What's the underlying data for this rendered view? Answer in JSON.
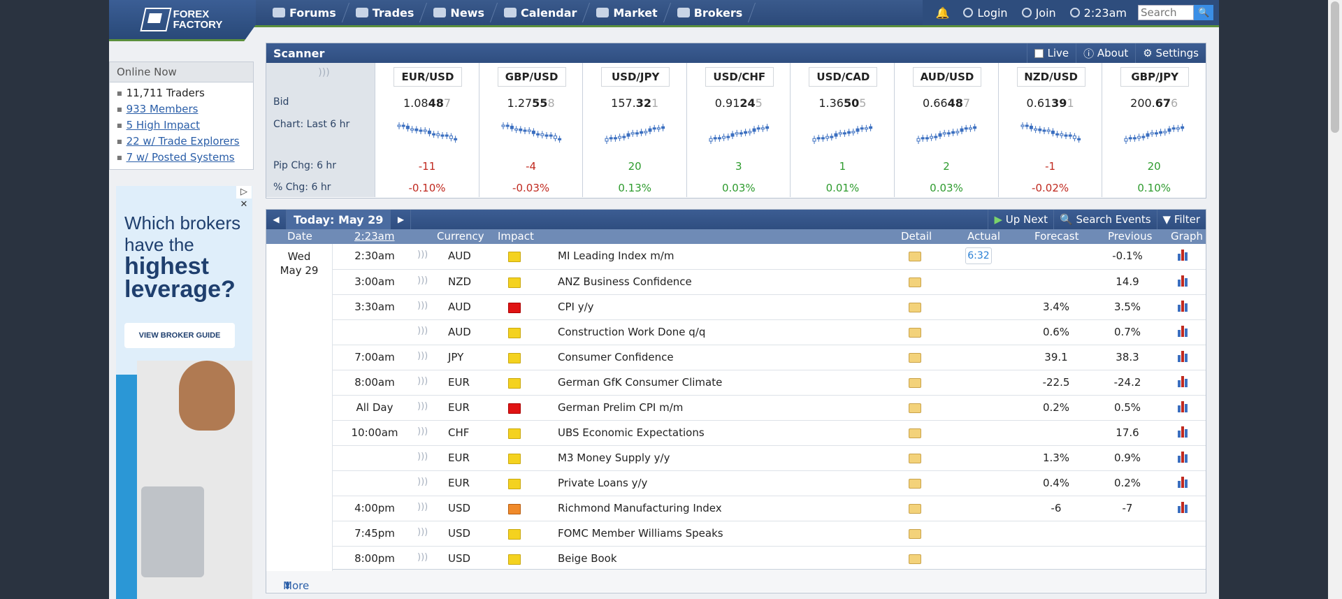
{
  "brand": {
    "logo_text_1": "FOREX",
    "logo_text_2": "FACTORY"
  },
  "nav": {
    "forums": "Forums",
    "trades": "Trades",
    "news": "News",
    "calendar": "Calendar",
    "market": "Market",
    "brokers": "Brokers"
  },
  "account": {
    "login": "Login",
    "join": "Join",
    "time": "2:23am",
    "search_placeholder": "Search"
  },
  "online": {
    "title": "Online Now",
    "traders": "11,711 Traders",
    "members": "933 Members",
    "high_impact": "5 High Impact",
    "trade_explorers": "22 w/ Trade Explorers",
    "posted_systems": "7 w/ Posted Systems"
  },
  "ad": {
    "headline_1": "Which brokers",
    "headline_2": "have the",
    "headline_3": "highest",
    "headline_4": "leverage?",
    "cta": "VIEW BROKER GUIDE"
  },
  "scanner": {
    "title": "Scanner",
    "live": "Live",
    "about": "About",
    "settings": "Settings",
    "labels": {
      "bid": "Bid",
      "chart": "Chart: Last 6 hr",
      "pip": "Pip Chg: 6 hr",
      "pct": "% Chg: 6 hr"
    },
    "pairs": [
      {
        "name": "EUR/USD",
        "bid_a": "1.08",
        "bid_b": "48",
        "bid_c": "7",
        "pip": "-11",
        "pct": "-0.10%",
        "dir": "neg"
      },
      {
        "name": "GBP/USD",
        "bid_a": "1.27",
        "bid_b": "55",
        "bid_c": "8",
        "pip": "-4",
        "pct": "-0.03%",
        "dir": "neg"
      },
      {
        "name": "USD/JPY",
        "bid_a": "157.",
        "bid_b": "32",
        "bid_c": "1",
        "pip": "20",
        "pct": "0.13%",
        "dir": "pos"
      },
      {
        "name": "USD/CHF",
        "bid_a": "0.91",
        "bid_b": "24",
        "bid_c": "5",
        "pip": "3",
        "pct": "0.03%",
        "dir": "pos"
      },
      {
        "name": "USD/CAD",
        "bid_a": "1.36",
        "bid_b": "50",
        "bid_c": "5",
        "pip": "1",
        "pct": "0.01%",
        "dir": "pos"
      },
      {
        "name": "AUD/USD",
        "bid_a": "0.66",
        "bid_b": "48",
        "bid_c": "7",
        "pip": "2",
        "pct": "0.03%",
        "dir": "pos"
      },
      {
        "name": "NZD/USD",
        "bid_a": "0.61",
        "bid_b": "39",
        "bid_c": "1",
        "pip": "-1",
        "pct": "-0.02%",
        "dir": "neg"
      },
      {
        "name": "GBP/JPY",
        "bid_a": "200.",
        "bid_b": "67",
        "bid_c": "6",
        "pip": "20",
        "pct": "0.10%",
        "dir": "pos"
      }
    ]
  },
  "calendar": {
    "today": "Today: May 29",
    "up_next": "Up Next",
    "search_events": "Search Events",
    "filter": "Filter",
    "headers": {
      "date": "Date",
      "time": "2:23am",
      "currency": "Currency",
      "impact": "Impact",
      "detail": "Detail",
      "actual": "Actual",
      "forecast": "Forecast",
      "previous": "Previous",
      "graph": "Graph"
    },
    "day": "Wed",
    "date": "May 29",
    "actual_first": "6:32",
    "events": [
      {
        "time": "2:30am",
        "cur": "AUD",
        "impact": "y",
        "name": "MI Leading Index m/m",
        "forecast": "",
        "previous": "-0.1%",
        "graph": true
      },
      {
        "time": "3:00am",
        "cur": "NZD",
        "impact": "y",
        "name": "ANZ Business Confidence",
        "forecast": "",
        "previous": "14.9",
        "graph": true
      },
      {
        "time": "3:30am",
        "cur": "AUD",
        "impact": "r",
        "name": "CPI y/y",
        "forecast": "3.4%",
        "previous": "3.5%",
        "graph": true
      },
      {
        "time": "",
        "cur": "AUD",
        "impact": "y",
        "name": "Construction Work Done q/q",
        "forecast": "0.6%",
        "previous": "0.7%",
        "graph": true
      },
      {
        "time": "7:00am",
        "cur": "JPY",
        "impact": "y",
        "name": "Consumer Confidence",
        "forecast": "39.1",
        "previous": "38.3",
        "graph": true
      },
      {
        "time": "8:00am",
        "cur": "EUR",
        "impact": "y",
        "name": "German GfK Consumer Climate",
        "forecast": "-22.5",
        "previous": "-24.2",
        "graph": true
      },
      {
        "time": "All Day",
        "cur": "EUR",
        "impact": "r",
        "name": "German Prelim CPI m/m",
        "forecast": "0.2%",
        "previous": "0.5%",
        "graph": true
      },
      {
        "time": "10:00am",
        "cur": "CHF",
        "impact": "y",
        "name": "UBS Economic Expectations",
        "forecast": "",
        "previous": "17.6",
        "graph": true
      },
      {
        "time": "",
        "cur": "EUR",
        "impact": "y",
        "name": "M3 Money Supply y/y",
        "forecast": "1.3%",
        "previous": "0.9%",
        "graph": true
      },
      {
        "time": "",
        "cur": "EUR",
        "impact": "y",
        "name": "Private Loans y/y",
        "forecast": "0.4%",
        "previous": "0.2%",
        "graph": true
      },
      {
        "time": "4:00pm",
        "cur": "USD",
        "impact": "o",
        "name": "Richmond Manufacturing Index",
        "forecast": "-6",
        "previous": "-7",
        "graph": true
      },
      {
        "time": "7:45pm",
        "cur": "USD",
        "impact": "y",
        "name": "FOMC Member Williams Speaks",
        "forecast": "",
        "previous": "",
        "graph": false
      },
      {
        "time": "8:00pm",
        "cur": "USD",
        "impact": "y",
        "name": "Beige Book",
        "forecast": "",
        "previous": "",
        "graph": false
      }
    ],
    "more": "More"
  },
  "colors": {
    "nav_bg": "#2f4e80",
    "accent_green": "#5b8f3c",
    "neg": "#c0291f",
    "pos": "#2e9b2e"
  }
}
